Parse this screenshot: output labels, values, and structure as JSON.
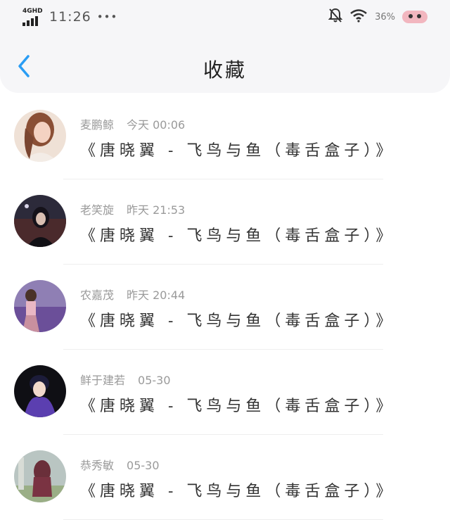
{
  "status_bar": {
    "network": "4GHD",
    "time": "11:26",
    "dots": "•••",
    "battery_percent": "36%"
  },
  "header": {
    "title": "收藏",
    "back_icon": "chevron-left-icon",
    "back_color": "#2a9df4"
  },
  "favorites": [
    {
      "user": "麦鹏鲸",
      "time": "今天 00:06",
      "title": "《唐晓翼 - 飞鸟与鱼（毒舌盒子）》"
    },
    {
      "user": "老笑旋",
      "time": "昨天 21:53",
      "title": "《唐晓翼 - 飞鸟与鱼（毒舌盒子）》"
    },
    {
      "user": "农嘉茂",
      "time": "昨天 20:44",
      "title": "《唐晓翼 - 飞鸟与鱼（毒舌盒子）》"
    },
    {
      "user": "鲜于建若",
      "time": "05-30",
      "title": "《唐晓翼 - 飞鸟与鱼（毒舌盒子）》"
    },
    {
      "user": "恭秀敏",
      "time": "05-30",
      "title": "《唐晓翼 - 飞鸟与鱼（毒舌盒子）》"
    }
  ]
}
